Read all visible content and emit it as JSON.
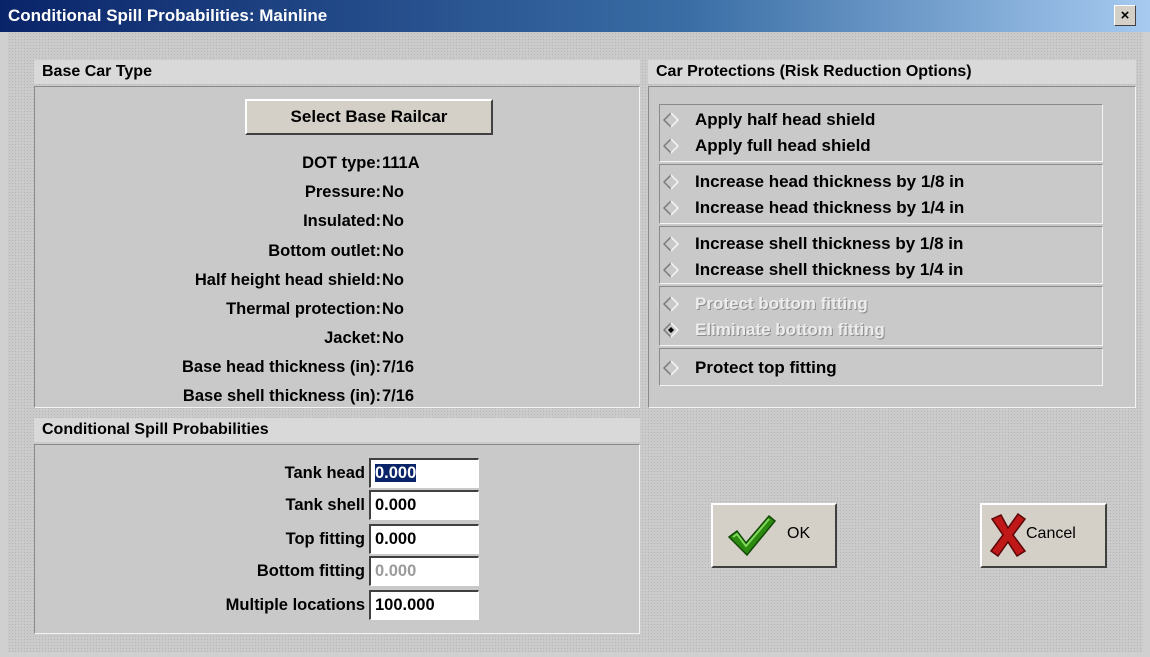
{
  "window": {
    "title": "Conditional Spill Probabilities: Mainline",
    "close_label": "×"
  },
  "base_car": {
    "header": "Base Car Type",
    "select_button": "Select Base Railcar",
    "properties": [
      {
        "label": "DOT type:",
        "value": "111A"
      },
      {
        "label": "Pressure:",
        "value": "No"
      },
      {
        "label": "Insulated:",
        "value": "No"
      },
      {
        "label": "Bottom outlet:",
        "value": "No"
      },
      {
        "label": "Half height head shield:",
        "value": "No"
      },
      {
        "label": "Thermal protection:",
        "value": "No"
      },
      {
        "label": "Jacket:",
        "value": "No"
      },
      {
        "label": "Base head thickness (in):",
        "value": "7/16"
      },
      {
        "label": "Base shell thickness (in):",
        "value": "7/16"
      }
    ]
  },
  "probabilities": {
    "header": "Conditional Spill Probabilities",
    "fields": [
      {
        "label": "Tank head",
        "value": "0.000",
        "selected": true,
        "disabled": false
      },
      {
        "label": "Tank shell",
        "value": "0.000",
        "selected": false,
        "disabled": false
      },
      {
        "label": "Top fitting",
        "value": "0.000",
        "selected": false,
        "disabled": false
      },
      {
        "label": "Bottom fitting",
        "value": "0.000",
        "selected": false,
        "disabled": true
      },
      {
        "label": "Multiple locations",
        "value": "100.000",
        "selected": false,
        "disabled": false
      }
    ]
  },
  "protections": {
    "header": "Car Protections (Risk Reduction Options)",
    "options": [
      {
        "label": "Apply half head shield",
        "checked": false,
        "disabled": false
      },
      {
        "label": "Apply full head shield",
        "checked": false,
        "disabled": false
      },
      {
        "label": "Increase head thickness by 1/8 in",
        "checked": false,
        "disabled": false
      },
      {
        "label": "Increase head thickness by 1/4 in",
        "checked": false,
        "disabled": false
      },
      {
        "label": "Increase shell thickness by 1/8 in",
        "checked": false,
        "disabled": false
      },
      {
        "label": "Increase shell thickness by 1/4 in",
        "checked": false,
        "disabled": false
      },
      {
        "label": "Protect bottom fitting",
        "checked": false,
        "disabled": true
      },
      {
        "label": "Eliminate bottom fitting",
        "checked": true,
        "disabled": true
      },
      {
        "label": "Protect top fitting",
        "checked": false,
        "disabled": false
      }
    ]
  },
  "buttons": {
    "ok_label": "OK",
    "cancel_label": "Cancel"
  },
  "colors": {
    "titlebar_start": "#0a246a",
    "titlebar_end": "#a6caf0",
    "ok_check": "#2d8a10",
    "cancel_x": "#c01818",
    "selection": "#0a246a"
  },
  "icons": {
    "ok": "check-icon",
    "cancel": "x-icon",
    "radio": "diamond-radio-icon"
  }
}
